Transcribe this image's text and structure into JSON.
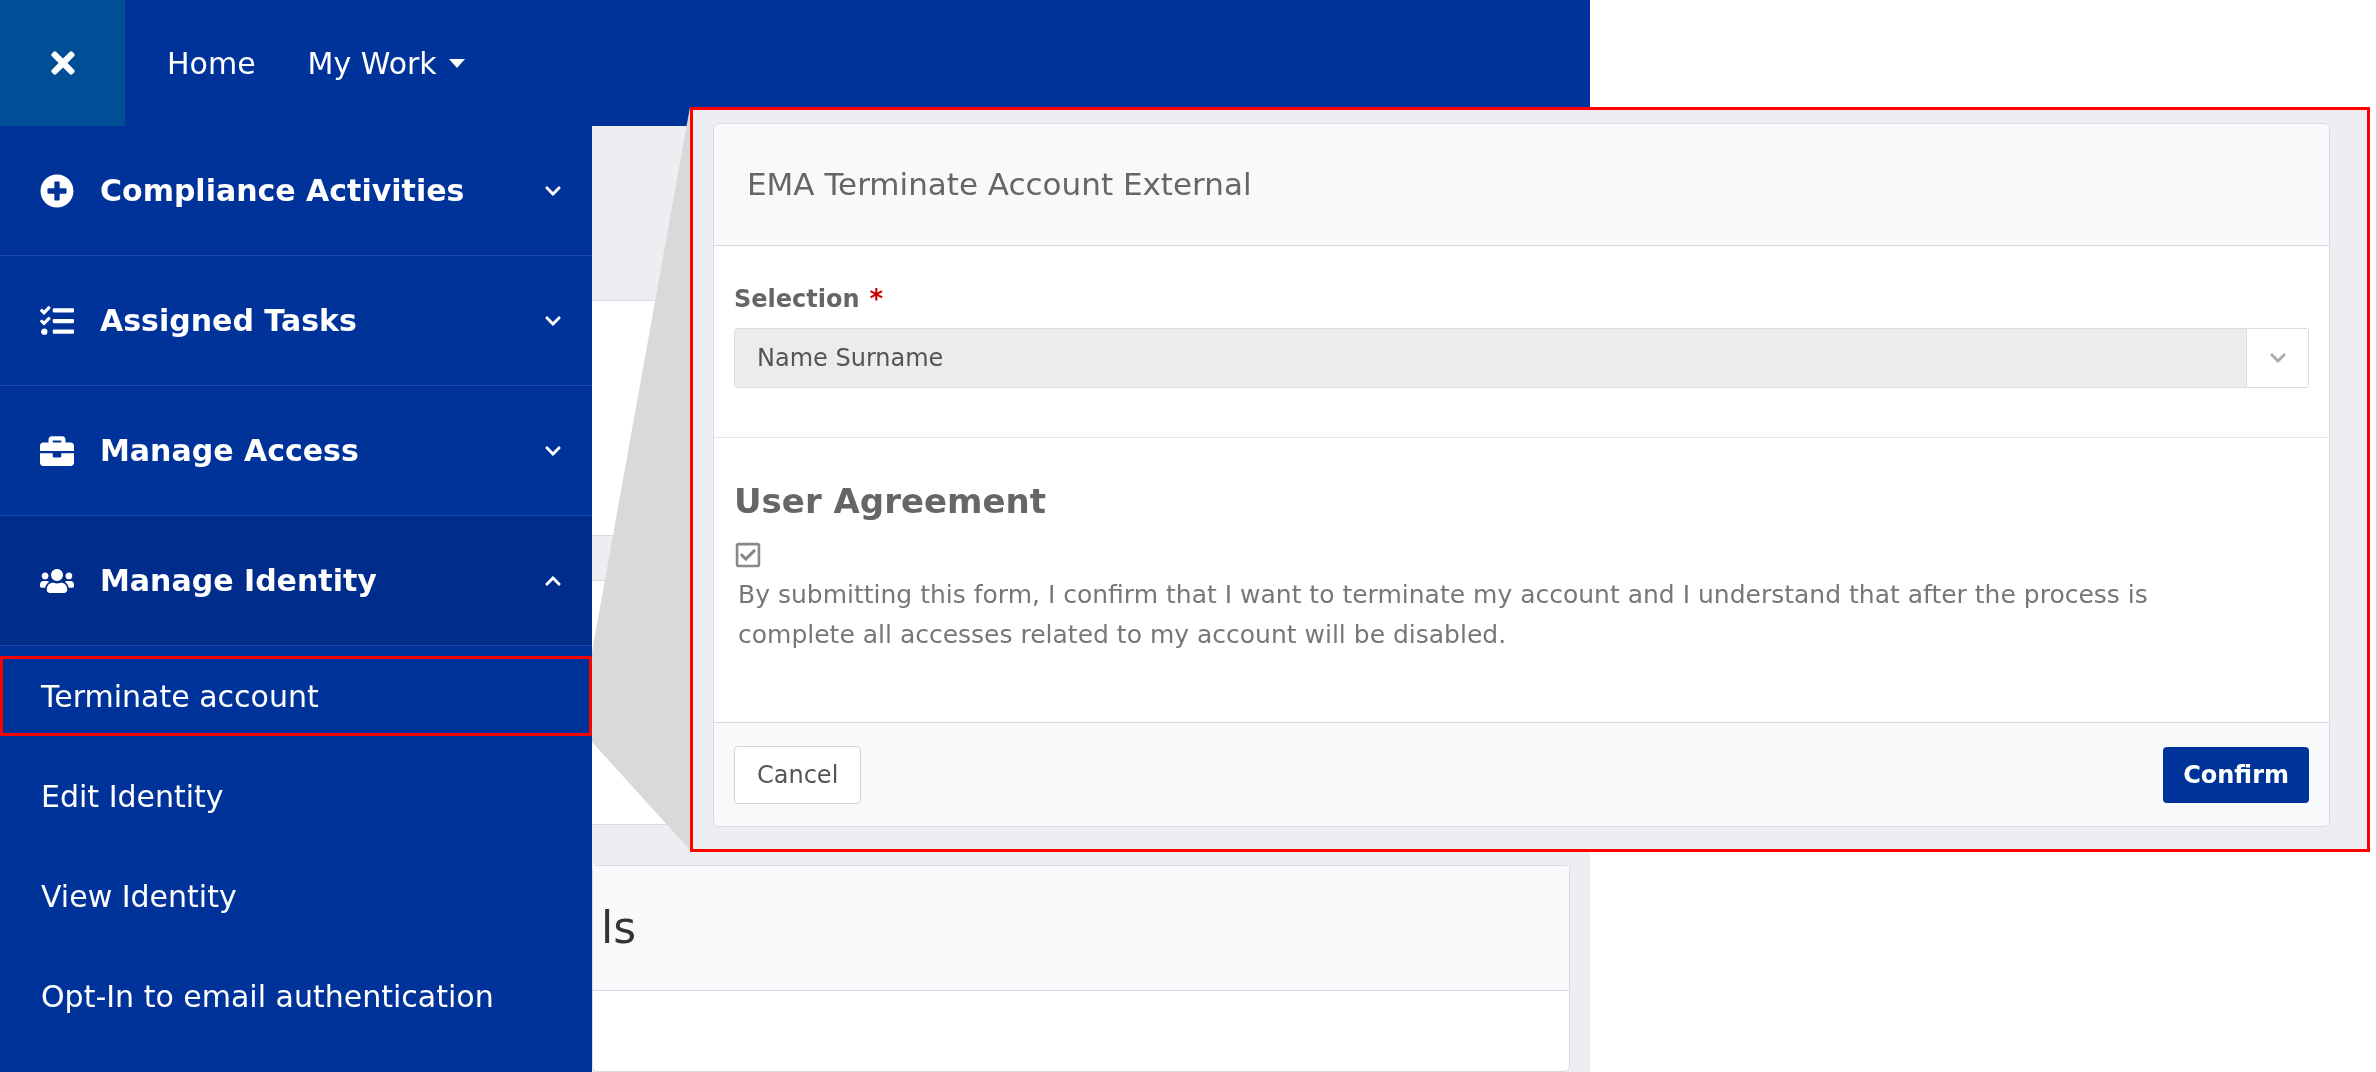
{
  "top_nav": {
    "items": [
      {
        "label": "Home",
        "dropdown": false
      },
      {
        "label": "My Work",
        "dropdown": true
      }
    ]
  },
  "sidebar": {
    "sections": [
      {
        "label": "Compliance Activities",
        "expanded": false
      },
      {
        "label": "Assigned Tasks",
        "expanded": false
      },
      {
        "label": "Manage Access",
        "expanded": false
      },
      {
        "label": "Manage Identity",
        "expanded": true,
        "children": [
          {
            "label": "Terminate account",
            "selected": true
          },
          {
            "label": "Edit Identity",
            "selected": false
          },
          {
            "label": "View Identity",
            "selected": false
          },
          {
            "label": "Opt-In to email authentication",
            "selected": false
          }
        ]
      }
    ]
  },
  "background_card": {
    "title_fragment": "ls"
  },
  "form": {
    "title": "EMA Terminate Account External",
    "field_label": "Selection",
    "required_mark": "*",
    "select_value": "Name Surname",
    "section_heading": "User Agreement",
    "agreement_checked": true,
    "agreement_text": "By submitting this form, I confirm that I want to terminate my account and I understand that after the process is complete all accesses related to my account will be disabled.",
    "buttons": {
      "cancel": "Cancel",
      "confirm": "Confirm"
    }
  }
}
